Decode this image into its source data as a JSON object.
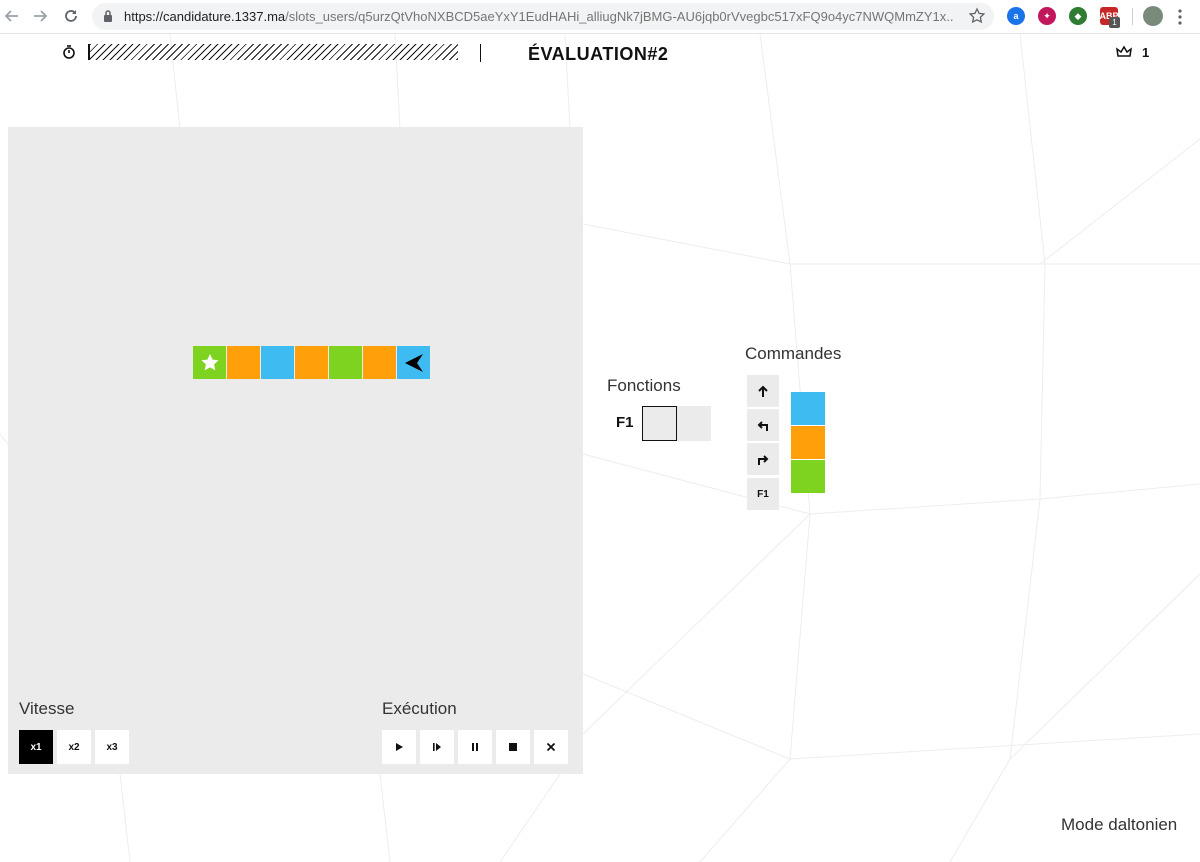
{
  "browser": {
    "url_host": "https://candidature.1337.ma",
    "url_path": "/slots_users/q5urzQtVhoNXBCD5aeYxY1EudHAHi_alliugNk7jBMG-AU6jqb0rVvegbc517xFQ9o4yc7NWQMmZY1x...",
    "extension_badge": "1"
  },
  "header": {
    "title": "ÉVALUATION#2",
    "crown_count": "1",
    "time_progress": 1.0
  },
  "board": {
    "tiles": [
      {
        "color": "#7ed321",
        "content": "star"
      },
      {
        "color": "#ff9f0a",
        "content": ""
      },
      {
        "color": "#3ebbf0",
        "content": ""
      },
      {
        "color": "#ff9f0a",
        "content": ""
      },
      {
        "color": "#7ed321",
        "content": ""
      },
      {
        "color": "#ff9f0a",
        "content": ""
      },
      {
        "color": "#3ebbf0",
        "content": "arrow-left"
      }
    ],
    "speed_label": "Vitesse",
    "speed_options": [
      "x1",
      "x2",
      "x3"
    ],
    "speed_selected": "x1",
    "exec_label": "Exécution",
    "exec_icons": [
      "play-icon",
      "step-icon",
      "pause-icon",
      "stop-icon",
      "clear-icon"
    ]
  },
  "functions": {
    "label": "Fonctions",
    "f1_label": "F1"
  },
  "commands": {
    "label": "Commandes",
    "buttons": [
      "forward-icon",
      "turn-left-icon",
      "turn-right-icon",
      "F1"
    ],
    "colors": [
      "#3ebbf0",
      "#ff9f0a",
      "#7ed321"
    ]
  },
  "footer": {
    "colorblind_mode": "Mode daltonien"
  }
}
